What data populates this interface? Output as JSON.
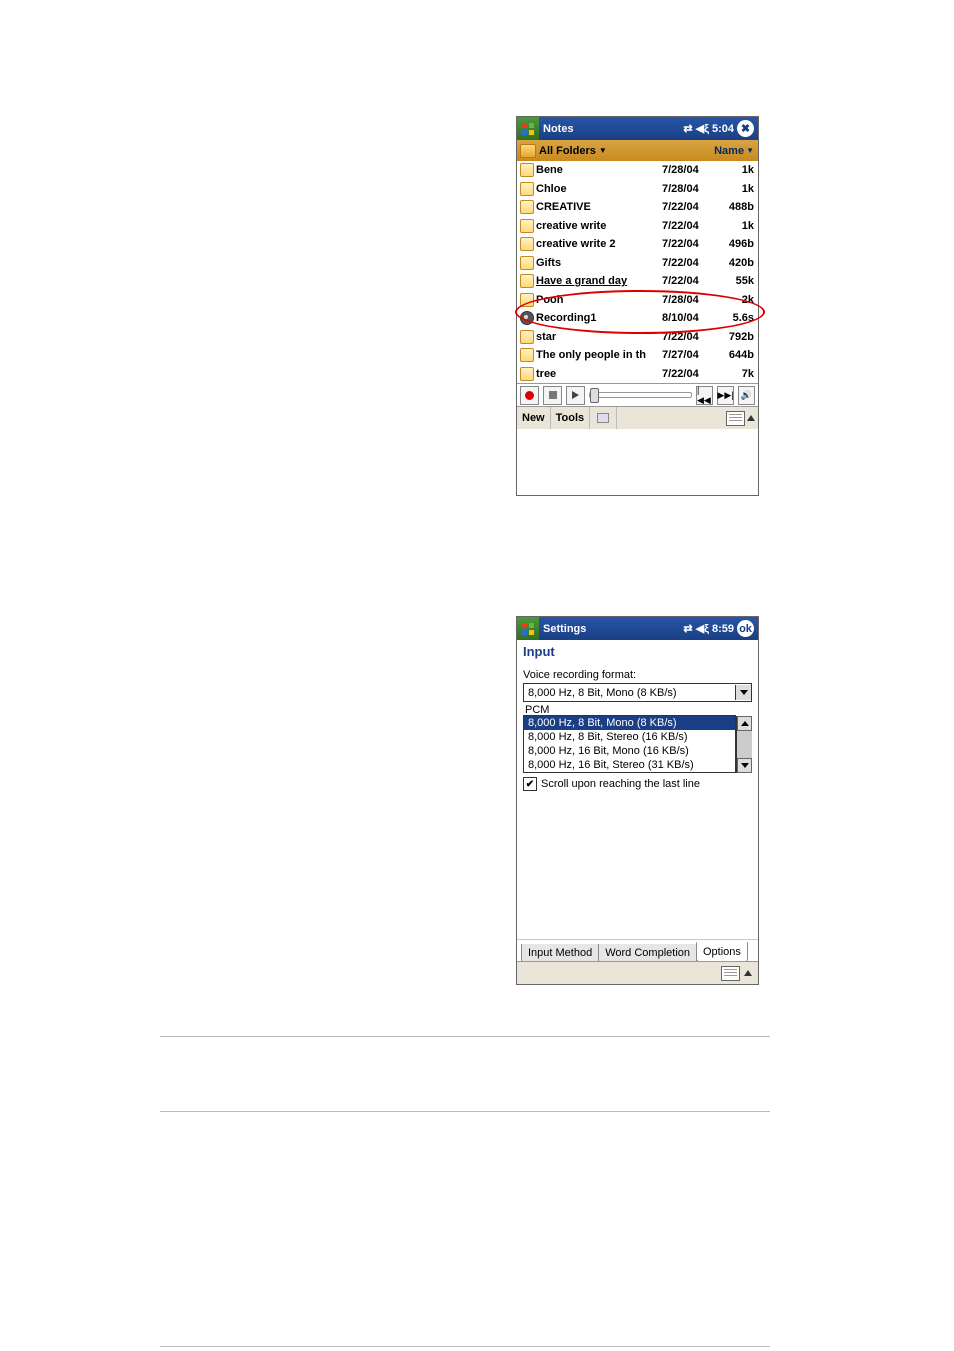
{
  "device1": {
    "title": "Notes",
    "time": "5:04",
    "close_glyph": "✖",
    "signal_glyph": "⇄",
    "speaker_glyph": "◀ξ",
    "folder_sel": "All Folders",
    "sort_label": "Name",
    "rows": [
      {
        "icon": "note",
        "name": "Bene",
        "under": false,
        "date": "7/28/04",
        "size": "1k"
      },
      {
        "icon": "note",
        "name": "Chloe",
        "under": false,
        "date": "7/28/04",
        "size": "1k"
      },
      {
        "icon": "note",
        "name": "CREATIVE",
        "under": false,
        "date": "7/22/04",
        "size": "488b"
      },
      {
        "icon": "note",
        "name": "creative write",
        "under": false,
        "date": "7/22/04",
        "size": "1k"
      },
      {
        "icon": "note",
        "name": "creative write 2",
        "under": false,
        "date": "7/22/04",
        "size": "496b"
      },
      {
        "icon": "note",
        "name": "Gifts",
        "under": false,
        "date": "7/22/04",
        "size": "420b"
      },
      {
        "icon": "note",
        "name": "Have a grand day",
        "under": true,
        "date": "7/22/04",
        "size": "55k"
      },
      {
        "icon": "note",
        "name": "Pooh",
        "under": false,
        "date": "7/28/04",
        "size": "2k"
      },
      {
        "icon": "rec",
        "name": "Recording1",
        "under": false,
        "date": "8/10/04",
        "size": "5.6s"
      },
      {
        "icon": "note",
        "name": "star",
        "under": false,
        "date": "7/22/04",
        "size": "792b"
      },
      {
        "icon": "note",
        "name": "The only people in th",
        "under": false,
        "date": "7/27/04",
        "size": "644b"
      },
      {
        "icon": "note",
        "name": "tree",
        "under": false,
        "date": "7/22/04",
        "size": "7k"
      }
    ],
    "menu_new": "New",
    "menu_tools": "Tools"
  },
  "device2": {
    "title": "Settings",
    "time": "8:59",
    "ok_label": "ok",
    "page_title": "Input",
    "label_format": "Voice recording format:",
    "combo_value": "8,000 Hz, 8 Bit, Mono (8 KB/s)",
    "group_label": "PCM",
    "options": [
      "8,000 Hz, 8 Bit, Mono (8 KB/s)",
      "8,000 Hz, 8 Bit, Stereo (16 KB/s)",
      "8,000 Hz, 16 Bit, Mono (16 KB/s)",
      "8,000 Hz, 16 Bit, Stereo (31 KB/s)"
    ],
    "selected_index": 0,
    "checkbox_label": "Scroll upon reaching the last line",
    "checkbox_checked": true,
    "tabs": [
      "Input Method",
      "Word Completion",
      "Options"
    ],
    "active_tab": 2
  }
}
